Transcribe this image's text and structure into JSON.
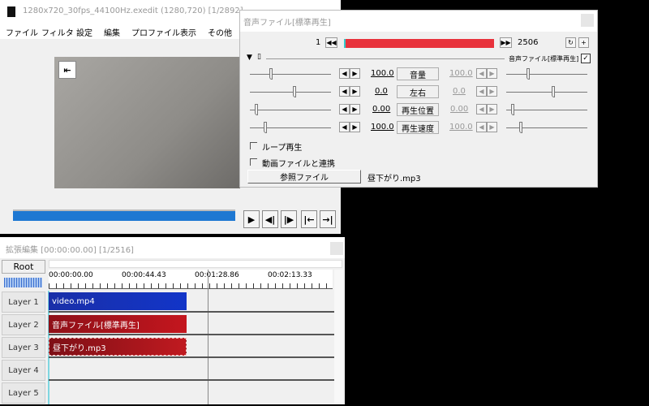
{
  "main_window": {
    "title": "1280x720_30fps_44100Hz.exedit (1280,720)  [1/2892]",
    "menu": [
      "ファイル",
      "フィルタ",
      "設定",
      "編集",
      "プロファイル",
      "表示",
      "その他"
    ],
    "controls": [
      "play-icon",
      "prev-frame-icon",
      "next-frame-icon",
      "jump-start-icon",
      "jump-end-icon"
    ],
    "seek_progress": 1.0
  },
  "audio_dialog": {
    "title": "音声ファイル[標準再生]",
    "start_frame": "1",
    "end_frame": "2506",
    "object_name": "音声ファイル[標準再生]",
    "enabled": true,
    "params": [
      {
        "label": "音量",
        "value": "100.0",
        "end_value": "100.0"
      },
      {
        "label": "左右",
        "value": "0.0",
        "end_value": "0.0"
      },
      {
        "label": "再生位置",
        "value": "0.00",
        "end_value": "0.00"
      },
      {
        "label": "再生速度",
        "value": "100.0",
        "end_value": "100.0"
      }
    ],
    "loop_label": "ループ再生",
    "loop_checked": false,
    "link_label": "動画ファイルと連携",
    "link_checked": false,
    "ref_button": "参照ファイル",
    "filename": "昼下がり.mp3",
    "bar_color": "#e8323c"
  },
  "timeline": {
    "title": "拡張編集 [00:00:00.00] [1/2516]",
    "root_label": "Root",
    "ticks": [
      "00:00:00.00",
      "00:00:44.43",
      "00:01:28.86",
      "00:02:13.33"
    ],
    "layers": [
      "Layer 1",
      "Layer 2",
      "Layer 3",
      "Layer 4",
      "Layer 5"
    ],
    "clips": [
      {
        "label": "video.mp4",
        "color": "#1a2fa8"
      },
      {
        "label": "音声ファイル[標準再生]",
        "color": "#b0141c"
      },
      {
        "label": "昼下がり.mp3",
        "color": "#9c1219"
      }
    ]
  }
}
